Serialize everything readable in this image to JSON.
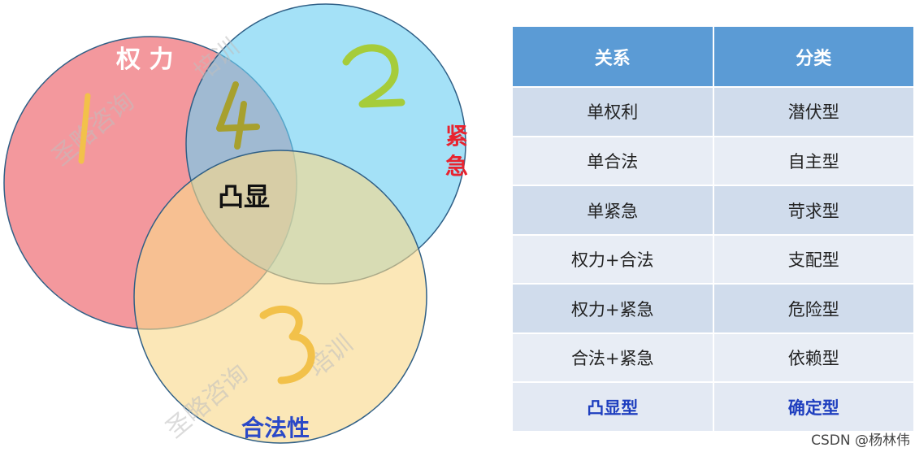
{
  "venn": {
    "labels": {
      "power": "权 力",
      "urgency_line1": "紧",
      "urgency_line2": "急",
      "legitimacy": "合法性",
      "center": "凸显"
    },
    "watermarks": [
      "圣略咨询",
      "培训",
      "圣略咨询",
      "培训"
    ],
    "colors": {
      "power": "#ef7b82",
      "urgency": "#6ccff2",
      "legitimacy": "#f8d98a",
      "urgency_label": "#e8232f",
      "legitimacy_label": "#2b49c7",
      "circle_stroke": "#2f5f86"
    }
  },
  "table": {
    "headers": [
      "关系",
      "分类"
    ],
    "rows": [
      [
        "单权利",
        "潜伏型"
      ],
      [
        "单合法",
        "自主型"
      ],
      [
        "单紧急",
        "苛求型"
      ],
      [
        "权力+合法",
        "支配型"
      ],
      [
        "权力+紧急",
        "危险型"
      ],
      [
        "合法+紧急",
        "依赖型"
      ],
      [
        "凸显型",
        "确定型"
      ]
    ],
    "colors": {
      "header_bg": "#5b9bd5",
      "last_row_text": "#1f3fbf"
    }
  },
  "footer": {
    "text": "CSDN @杨林伟"
  }
}
